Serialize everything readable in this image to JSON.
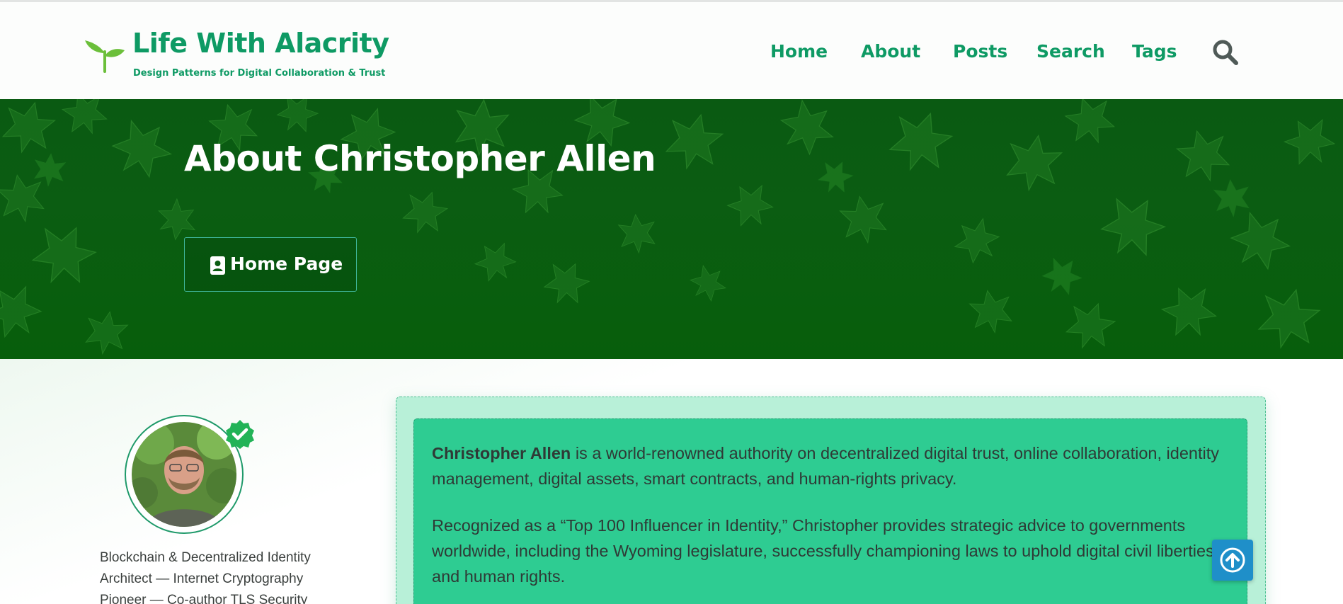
{
  "header": {
    "site_title": "Life With Alacrity",
    "tagline": "Design Patterns for Digital Collaboration & Trust",
    "logo_icon": "sprout-icon",
    "nav": [
      {
        "label": "Home"
      },
      {
        "label": "About"
      },
      {
        "label": "Posts"
      },
      {
        "label": "Search"
      },
      {
        "label": "Tags"
      }
    ],
    "search_icon": "search-icon"
  },
  "hero": {
    "title": "About Christopher Allen",
    "button_label": "Home Page",
    "button_icon": "id-card-icon"
  },
  "profile": {
    "verified_icon": "verified-check-icon",
    "bio": "Blockchain & Decentralized Identity Architect — Internet Cryptography Pioneer — Co-author TLS Security"
  },
  "about": {
    "p1_name": "Christopher Allen",
    "p1_rest": " is a world-renowned authority on decentralized digital trust, online collaboration, identity management, digital assets, smart contracts, and human-rights privacy.",
    "p2": "Recognized as a “Top 100 Influencer in Identity,” Christopher provides strategic advice to governments worldwide, including the Wyoming legislature, successfully championing laws to uphold digital civil liberties and human rights."
  },
  "scroll_top_icon": "arrow-up-circle-icon",
  "colors": {
    "brand_green": "#0e9a64",
    "hero_green": "#0b5d12",
    "card_green": "#2ecc92",
    "card_outer": "#b8f0d8",
    "scroll_button": "#1f8fc9"
  }
}
